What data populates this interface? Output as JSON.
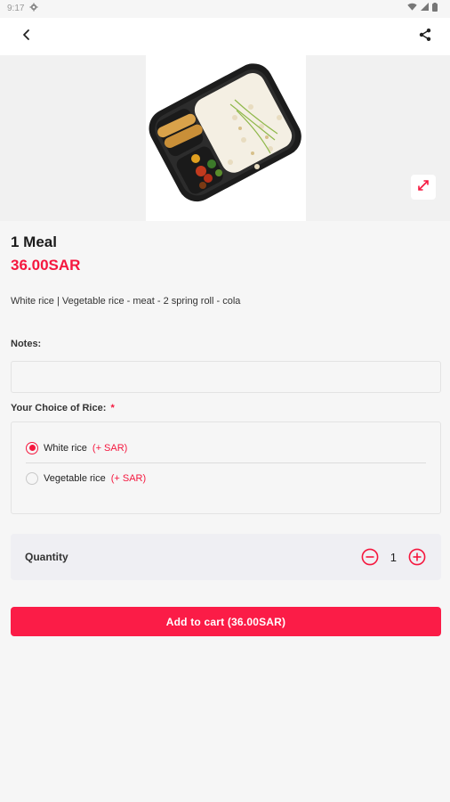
{
  "status_bar": {
    "time": "9:17"
  },
  "icons": {
    "back": "arrow-left-icon",
    "share": "share-icon",
    "expand": "expand-icon",
    "decrease": "minus-circle-icon",
    "increase": "plus-circle-icon"
  },
  "product": {
    "name": "1 Meal",
    "price": "36.00SAR",
    "description": "White rice | Vegetable rice - meat - 2 spring roll - cola"
  },
  "notes": {
    "label": "Notes:",
    "value": "",
    "placeholder": ""
  },
  "rice_choice": {
    "label": "Your Choice of Rice:",
    "required_marker": "*",
    "options": [
      {
        "label": "White rice",
        "extra": "(+ SAR)",
        "selected": true
      },
      {
        "label": "Vegetable rice",
        "extra": "(+ SAR)",
        "selected": false
      }
    ]
  },
  "quantity": {
    "label": "Quantity",
    "value": "1"
  },
  "cart_button": {
    "label": "Add to cart (36.00SAR)"
  },
  "colors": {
    "accent": "#f5173e",
    "button": "#fb1c47",
    "background": "#f6f6f6"
  }
}
